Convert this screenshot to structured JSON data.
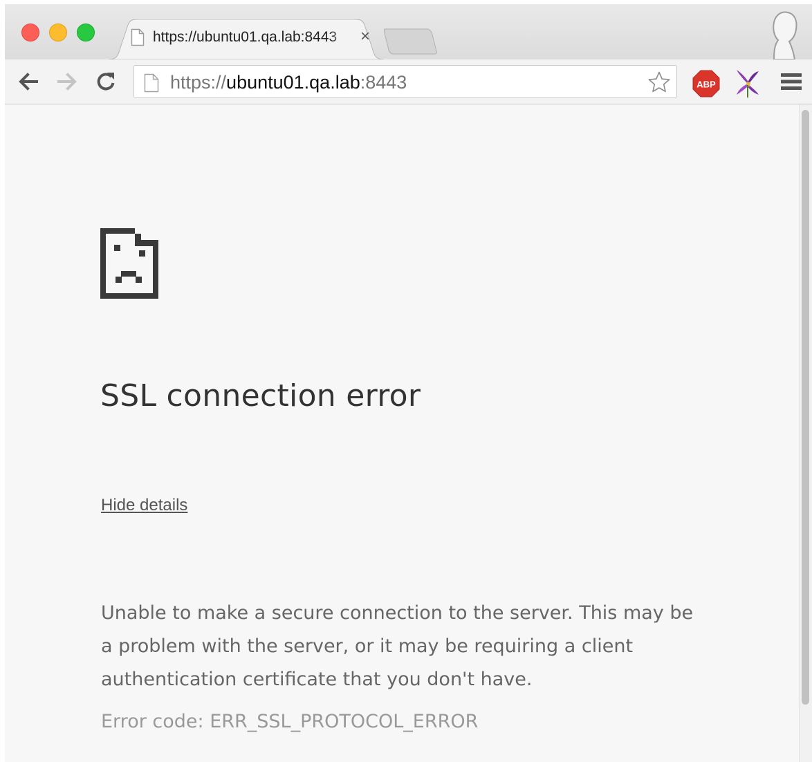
{
  "browser": {
    "tab": {
      "title": "https://ubuntu01.qa.lab:8443",
      "close_glyph": "×",
      "icon": "page-icon"
    },
    "address_bar": {
      "scheme": "https://",
      "host": "ubuntu01.qa.lab",
      "port": ":8443",
      "icon": "page-icon"
    },
    "toolbar_icons": [
      "back-arrow-icon",
      "forward-arrow-icon",
      "reload-icon",
      "star-icon",
      "adblock-plus-icon",
      "lily-extension-icon",
      "hamburger-menu-icon"
    ],
    "extensions": {
      "abp_label": "ABP"
    },
    "window_controls": [
      "close",
      "minimize",
      "zoom"
    ]
  },
  "error_page": {
    "icon": "sad-page-icon",
    "title": "SSL connection error",
    "details_link": "Hide details",
    "description": "Unable to make a secure connection to the server. This may be a problem with the server, or it may be requiring a client authentication certificate that you don't have.",
    "error_code": "Error code: ERR_SSL_PROTOCOL_ERROR"
  },
  "colors": {
    "close_button": "#fd5f57",
    "minimize_button": "#fdbc2e",
    "zoom_button": "#28c940",
    "abp_badge": "#d9352b",
    "page_background": "#f7f7f7"
  }
}
